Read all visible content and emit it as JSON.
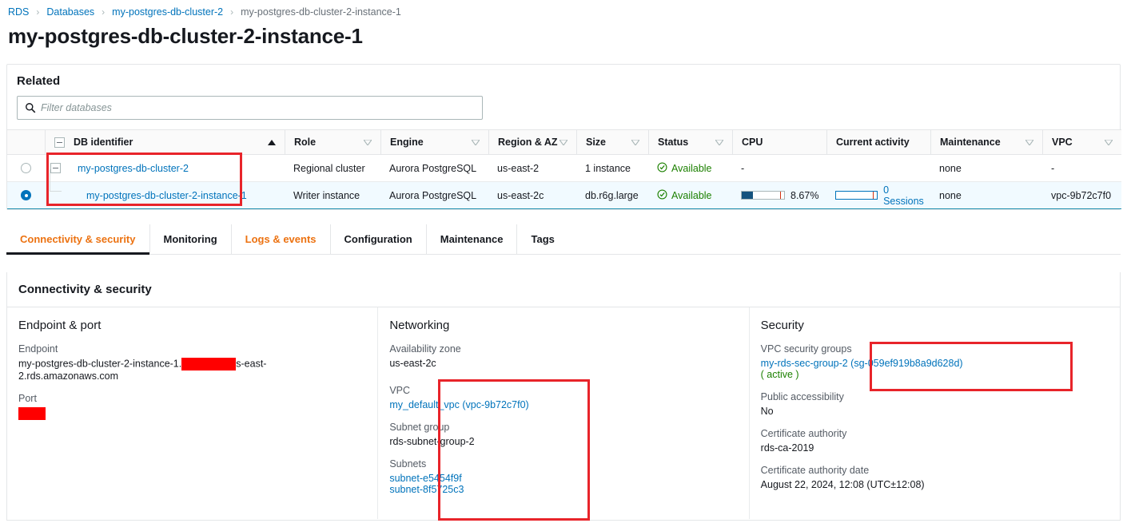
{
  "breadcrumb": {
    "items": [
      {
        "label": "RDS",
        "current": false
      },
      {
        "label": "Databases",
        "current": false
      },
      {
        "label": "my-postgres-db-cluster-2",
        "current": false
      },
      {
        "label": "my-postgres-db-cluster-2-instance-1",
        "current": true
      }
    ],
    "separator": "›"
  },
  "page": {
    "title": "my-postgres-db-cluster-2-instance-1"
  },
  "related": {
    "heading": "Related",
    "filter": {
      "placeholder": "Filter databases",
      "value": "",
      "icon": "search-icon"
    },
    "columns": [
      {
        "key": "select",
        "label": ""
      },
      {
        "key": "db_identifier",
        "label": "DB identifier",
        "sort": "asc"
      },
      {
        "key": "role",
        "label": "Role",
        "sort": "none"
      },
      {
        "key": "engine",
        "label": "Engine",
        "sort": "none"
      },
      {
        "key": "region_az",
        "label": "Region & AZ",
        "sort": "none"
      },
      {
        "key": "size",
        "label": "Size",
        "sort": "none"
      },
      {
        "key": "status",
        "label": "Status",
        "sort": "none"
      },
      {
        "key": "cpu",
        "label": "CPU",
        "sort": "none"
      },
      {
        "key": "current_activity",
        "label": "Current activity",
        "sort": "none"
      },
      {
        "key": "maintenance",
        "label": "Maintenance",
        "sort": "none"
      },
      {
        "key": "vpc",
        "label": "VPC",
        "sort": "none"
      }
    ],
    "rows": [
      {
        "selected": false,
        "indent": false,
        "expander": "collapse",
        "db_identifier": "my-postgres-db-cluster-2",
        "role": "Regional cluster",
        "engine": "Aurora PostgreSQL",
        "region_az": "us-east-2",
        "size": "1 instance",
        "status": "Available",
        "cpu": "-",
        "cpu_percent": null,
        "current_activity": "",
        "sessions": null,
        "maintenance": "none",
        "vpc": "-"
      },
      {
        "selected": true,
        "indent": true,
        "expander": "none",
        "db_identifier": "my-postgres-db-cluster-2-instance-1",
        "role": "Writer instance",
        "engine": "Aurora PostgreSQL",
        "region_az": "us-east-2c",
        "size": "db.r6g.large",
        "status": "Available",
        "cpu": "8.67%",
        "cpu_percent": 8.67,
        "current_activity": "0 Sessions",
        "sessions": 0,
        "maintenance": "none",
        "vpc": "vpc-9b72c7f0"
      }
    ]
  },
  "tabs": [
    {
      "label": "Connectivity & security",
      "state": "active"
    },
    {
      "label": "Monitoring",
      "state": "normal"
    },
    {
      "label": "Logs & events",
      "state": "hover"
    },
    {
      "label": "Configuration",
      "state": "normal"
    },
    {
      "label": "Maintenance",
      "state": "normal"
    },
    {
      "label": "Tags",
      "state": "normal"
    }
  ],
  "details": {
    "heading": "Connectivity & security",
    "endpoint_port": {
      "heading": "Endpoint & port",
      "endpoint_label": "Endpoint",
      "endpoint_prefix": "my-postgres-db-cluster-2-instance-1.",
      "endpoint_suffix": "s-east-2.rds.amazonaws.com",
      "endpoint_redacted": true,
      "port_label": "Port",
      "port_redacted": true
    },
    "networking": {
      "heading": "Networking",
      "az_label": "Availability zone",
      "az_value": "us-east-2c",
      "vpc_label": "VPC",
      "vpc_value": "my_default_vpc (vpc-9b72c7f0)",
      "subnet_group_label": "Subnet group",
      "subnet_group_value": "rds-subnet-group-2",
      "subnets_label": "Subnets",
      "subnets": [
        "subnet-e5454f9f",
        "subnet-8f5725c3"
      ]
    },
    "security": {
      "heading": "Security",
      "sg_label": "VPC security groups",
      "sg_value": "my-rds-sec-group-2 (sg-059ef919b8a9d628d)",
      "sg_state": "( active )",
      "public_label": "Public accessibility",
      "public_value": "No",
      "ca_label": "Certificate authority",
      "ca_value": "rds-ca-2019",
      "ca_date_label": "Certificate authority date",
      "ca_date_value": "August 22, 2024, 12:08 (UTC±12:08)"
    }
  },
  "colors": {
    "link": "#0073bb",
    "accent_orange": "#ec7211",
    "status_green": "#1d8102",
    "annotation_red": "#e8242a",
    "redaction_red": "#ff0000",
    "selected_row_bg": "#f1faff",
    "selected_row_border": "#1d8dad"
  }
}
